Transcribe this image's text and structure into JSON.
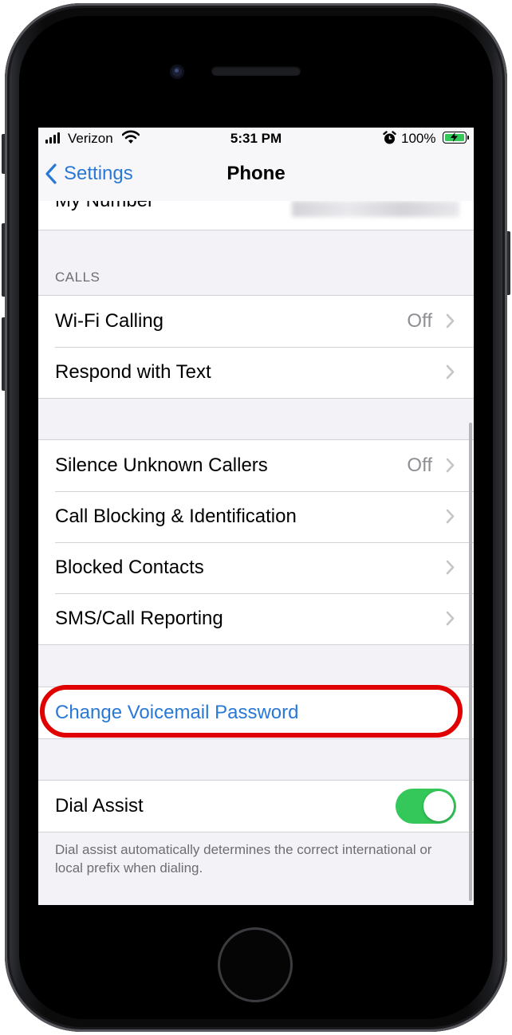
{
  "status_bar": {
    "carrier": "Verizon",
    "time": "5:31 PM",
    "battery_percent": "100%",
    "icons": [
      "signal-icon",
      "wifi-icon",
      "alarm-icon",
      "battery-charging-icon"
    ],
    "battery_color": "#34c759"
  },
  "navbar": {
    "back_label": "Settings",
    "title": "Phone"
  },
  "partial_row": {
    "label": "My Number"
  },
  "calls_section": {
    "header": "CALLS",
    "rows": [
      {
        "label": "Wi-Fi Calling",
        "value": "Off"
      },
      {
        "label": "Respond with Text",
        "value": ""
      }
    ]
  },
  "blocking_section": {
    "rows": [
      {
        "label": "Silence Unknown Callers",
        "value": "Off"
      },
      {
        "label": "Call Blocking & Identification",
        "value": ""
      },
      {
        "label": "Blocked Contacts",
        "value": ""
      },
      {
        "label": "SMS/Call Reporting",
        "value": ""
      }
    ]
  },
  "voicemail_section": {
    "label": "Change Voicemail Password",
    "link_color": "#2a78d6"
  },
  "dial_assist_section": {
    "label": "Dial Assist",
    "toggle_on": true,
    "toggle_color": "#34c759",
    "footer": "Dial assist automatically determines the correct international or local prefix when dialing."
  },
  "annotation": {
    "highlight_color": "#e00000"
  }
}
